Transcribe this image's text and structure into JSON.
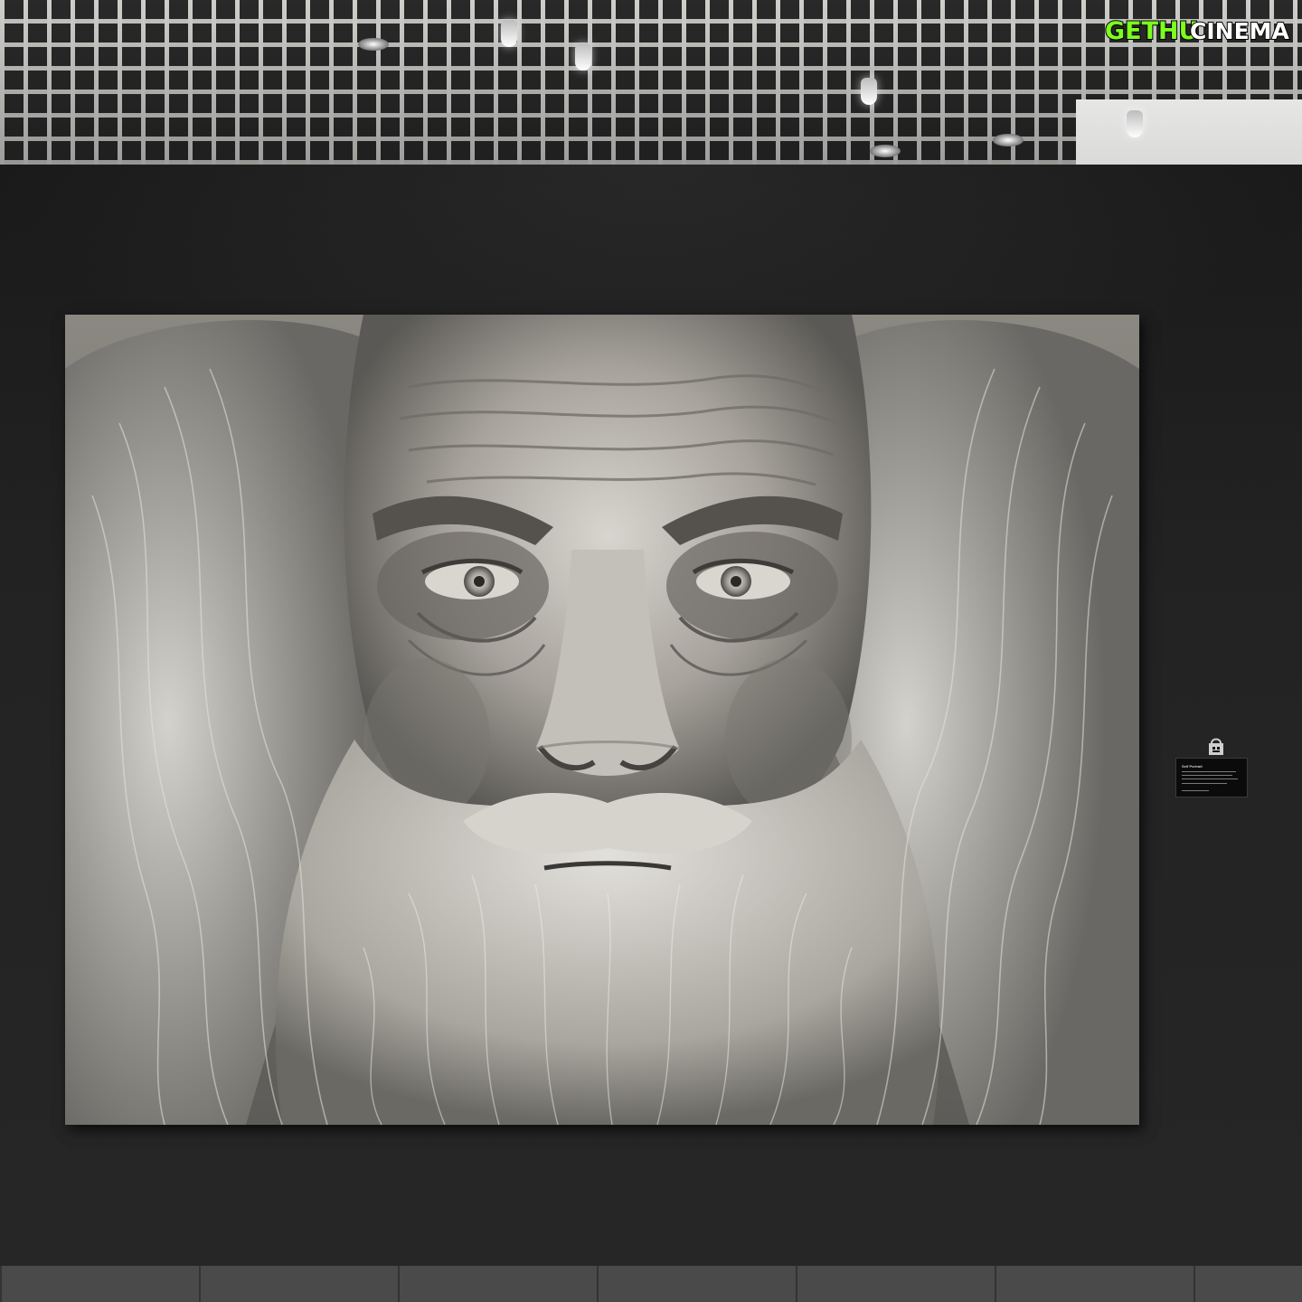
{
  "watermark": {
    "part1": "GETHU",
    "part2": "CINEMA",
    "color1": "#7CFF1E",
    "color2": "#FFFFFF",
    "outline": "#000000"
  },
  "wall_label": {
    "title": "Self Portrait"
  },
  "colors": {
    "wall": "#232323",
    "ceiling_grid": "#d9d9d6",
    "painting_base": "#6e6c68"
  }
}
